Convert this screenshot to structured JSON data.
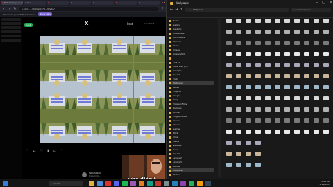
{
  "browser": {
    "tabs": [
      {
        "label": "Extend on your default browser"
      },
      {
        "label": "Ver"
      },
      {
        "label": ""
      },
      {
        "label": ""
      },
      {
        "label": ""
      },
      {
        "label": ""
      },
      {
        "label": ""
      }
    ],
    "new_tab": "+",
    "url": "x.com/...../status/1778.../photo/1",
    "bookmarks": [
      "Extend on your default browser",
      "Show tabs"
    ],
    "bookmark_chip": "Show tabs"
  },
  "viewer": {
    "generate_label": "Grok",
    "x_logo": "X",
    "post_title": "Post",
    "post_time": "10:43 AM",
    "bottom_icons": [
      "comment-icon",
      "repost-icon",
      "like-icon",
      "views-icon",
      "bookmark-icon",
      "share-icon"
    ],
    "profile_name": "Patrick Rock",
    "profile_handle": "@patrickr..."
  },
  "caption": "whe didn't",
  "explorer": {
    "title": "Wallpaper",
    "path": "... > Wallpaper",
    "search_placeholder": "Search Wallpaper",
    "window_buttons": [
      "–",
      "□",
      "×"
    ],
    "nav_items": [
      "Home",
      "Gallery",
      "Desktop",
      "Downloads",
      "Documents",
      "Pictures",
      "Music",
      "Videos",
      "Screenshots",
      "",
      "This PC",
      "Local Disk (C:)",
      "Data (D:)",
      "Recent",
      "Fonts",
      "Wallpaper",
      "Saved",
      "Projects",
      "Images",
      "Temp",
      "Program Files",
      "Backups",
      "Archive",
      "Program Data",
      "Assets",
      "Shared",
      "Games",
      "Work",
      "Clips",
      "Media",
      "Network",
      "Users",
      "Export",
      "Layers 2",
      "Layers 3",
      "Render",
      "Wallpaper",
      "Photos",
      "Exported",
      "My Art",
      "Source",
      "Icons",
      "Logos",
      "Effects",
      "Drafts",
      "AI Art",
      "Scripts",
      "Plugins",
      "Cache",
      "Textures",
      "Models",
      "Sounds",
      "Output",
      "Output B",
      "Other",
      "Misc",
      "Music 2",
      "Backgrounds",
      "Final",
      "Misc 2"
    ],
    "selected_nav": "Wallpaper"
  },
  "taskbar": {
    "search_placeholder": "Search",
    "clock_time": "10:43 AM",
    "clock_date": "4/12/2024"
  }
}
